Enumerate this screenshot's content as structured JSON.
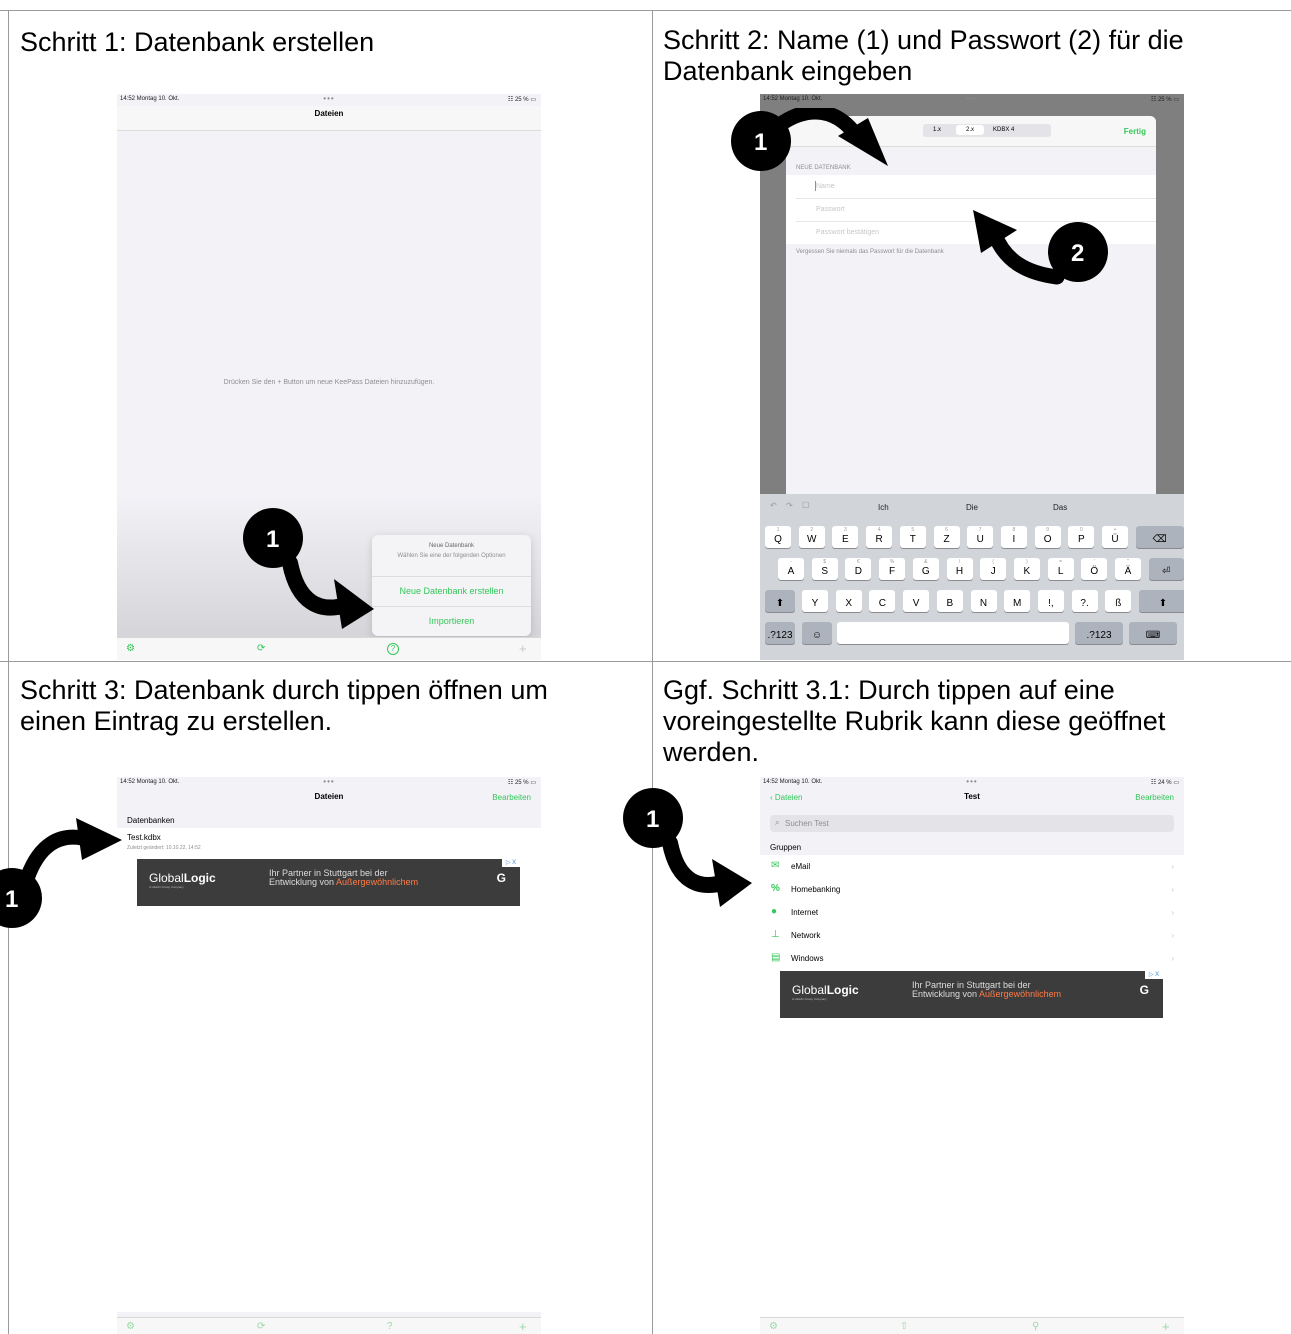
{
  "captions": {
    "step1": "Schritt 1: Datenbank erstellen",
    "step2_line1": "Schritt 2: Name (1) und Passwort (2) für die",
    "step2_line2": "Datenbank eingeben",
    "step3_line1": "Schritt 3: Datenbank durch tippen öffnen um",
    "step3_line2": "einen Eintrag zu erstellen.",
    "step31_line1": "Ggf. Schritt 3.1: Durch tippen auf eine",
    "step31_line2": "voreingestellte Rubrik kann diese geöffnet",
    "step31_line3": "werden."
  },
  "statusbar": {
    "time_date": "14:52  Montag 10. Okt.",
    "dots": "•••",
    "battery": "25 %",
    "battery2": "24 %"
  },
  "screen1": {
    "title": "Dateien",
    "empty_text": "Drücken Sie den + Button um neue KeePass Dateien hinzuzufügen.",
    "sheet_title": "Neue Datenbank",
    "sheet_sub": "Wählen Sie eine der folgenden Optionen",
    "sheet_create": "Neue Datenbank erstellen",
    "sheet_import": "Importieren",
    "badge": "1",
    "tabs": {
      "settings": "⚙",
      "sync": "⟳",
      "help": "?",
      "add": "+"
    }
  },
  "screen2": {
    "segments": [
      "1.x",
      "2.x",
      "KDBX 4"
    ],
    "done": "Fertig",
    "section": "NEUE DATENBANK",
    "name_placeholder": "Name",
    "password_placeholder": "Passwort",
    "confirm_placeholder": "Passwort bestätigen",
    "footer": "Vergessen Sie niemals das Passwort für die Datenbank",
    "suggestions": [
      "Ich",
      "Die",
      "Das"
    ],
    "badge1": "1",
    "badge2": "2",
    "keys": {
      "row1": [
        "Q",
        "W",
        "E",
        "R",
        "T",
        "Z",
        "U",
        "I",
        "O",
        "P",
        "Ü"
      ],
      "row1_sub": [
        "1",
        "2",
        "3",
        "4",
        "5",
        "6",
        "7",
        "8",
        "9",
        "0",
        "+"
      ],
      "row2": [
        "A",
        "S",
        "D",
        "F",
        "G",
        "H",
        "J",
        "K",
        "L",
        "Ö",
        "Ä"
      ],
      "row2_sub": [
        "-",
        "$",
        "€",
        "%",
        "&",
        "/",
        "(",
        ")",
        "=",
        "'",
        "\""
      ],
      "row3": [
        "Y",
        "X",
        "C",
        "V",
        "B",
        "N",
        "M",
        "!",
        ",",
        "?",
        ".",
        "ß"
      ],
      "numbers": ".?123",
      "emoji": "☺",
      "numbers_right": ".?123"
    }
  },
  "screen3": {
    "title": "Dateien",
    "edit": "Bearbeiten",
    "section": "Datenbanken",
    "file_name": "Test.kdbx",
    "file_meta": "Zuletzt geändert: 10.10.22, 14:52",
    "badge": "1"
  },
  "screen4": {
    "back": "Dateien",
    "title": "Test",
    "edit": "Bearbeiten",
    "search_placeholder": "Suchen Test",
    "section": "Gruppen",
    "groups": [
      "eMail",
      "Homebanking",
      "Internet",
      "Network",
      "Windows"
    ],
    "badge": "1"
  },
  "ad": {
    "logo_a": "Global",
    "logo_b": "Logic",
    "logo_sub": "A Hitachi Group Company",
    "text_1": "Ihr Partner in Stuttgart bei der",
    "text_2a": "Entwicklung von ",
    "text_2b": "Außergewöhnlichem",
    "close": "▷ X"
  },
  "colors": {
    "accent": "#34c759",
    "ad_bg": "#3c3c3c",
    "ad_highlight": "#ff7a45"
  }
}
